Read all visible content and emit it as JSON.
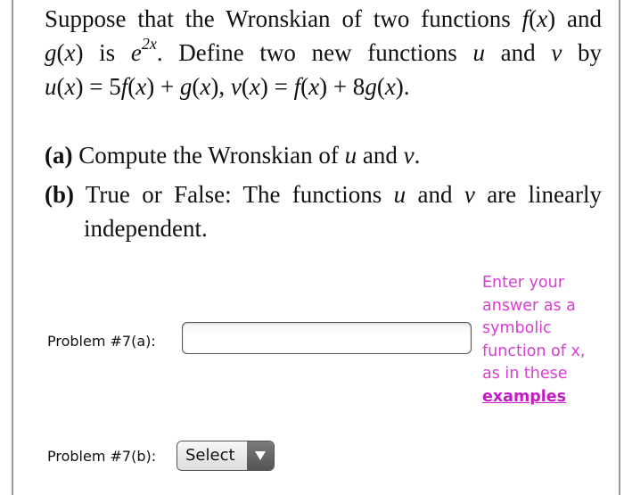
{
  "problem": {
    "intro_lines": [
      {
        "parts": [
          {
            "t": "Suppose that the Wronskian of two functions "
          },
          {
            "t": "f",
            "i": true
          },
          {
            "t": "("
          },
          {
            "t": "x",
            "i": true
          },
          {
            "t": ") and"
          }
        ]
      },
      {
        "parts": [
          {
            "t": "g",
            "i": true
          },
          {
            "t": "("
          },
          {
            "t": "x",
            "i": true
          },
          {
            "t": ") is "
          },
          {
            "t": "e",
            "i": true
          },
          {
            "t": "2x",
            "sup": true
          },
          {
            "t": ". Define two new functions "
          },
          {
            "t": "u",
            "i": true
          },
          {
            "t": " and "
          },
          {
            "t": "v",
            "i": true
          },
          {
            "t": " by"
          }
        ]
      },
      {
        "parts": [
          {
            "t": "u",
            "i": true
          },
          {
            "t": "("
          },
          {
            "t": "x",
            "i": true
          },
          {
            "t": ") = 5"
          },
          {
            "t": "f",
            "i": true
          },
          {
            "t": "("
          },
          {
            "t": "x",
            "i": true
          },
          {
            "t": ") + "
          },
          {
            "t": "g",
            "i": true
          },
          {
            "t": "("
          },
          {
            "t": "x",
            "i": true
          },
          {
            "t": "), "
          },
          {
            "t": "v",
            "i": true
          },
          {
            "t": "("
          },
          {
            "t": "x",
            "i": true
          },
          {
            "t": ") = "
          },
          {
            "t": "f",
            "i": true
          },
          {
            "t": "("
          },
          {
            "t": "x",
            "i": true
          },
          {
            "t": ") + 8"
          },
          {
            "t": "g",
            "i": true
          },
          {
            "t": "("
          },
          {
            "t": "x",
            "i": true
          },
          {
            "t": ")."
          }
        ]
      }
    ],
    "part_a": {
      "marker": "(a)",
      "parts": [
        {
          "t": " Compute the Wronskian of "
        },
        {
          "t": "u",
          "i": true
        },
        {
          "t": " and "
        },
        {
          "t": "v",
          "i": true
        },
        {
          "t": "."
        }
      ]
    },
    "part_b": {
      "marker": "(b)",
      "line1": [
        {
          "t": " True or False: The functions "
        },
        {
          "t": "u",
          "i": true
        },
        {
          "t": " and "
        },
        {
          "t": "v",
          "i": true
        },
        {
          "t": " are linearly"
        }
      ],
      "line2": "independent."
    }
  },
  "answers": {
    "a_label": "Problem #7(a):",
    "a_value": "",
    "hint_text": "Enter your answer as a symbolic function of x, as in these",
    "hint_lines": [
      "Enter your",
      "answer as a",
      "symbolic",
      "function of x,",
      "as in these"
    ],
    "hint_link": "examples",
    "b_label": "Problem #7(b):",
    "b_selected": "Select"
  },
  "colors": {
    "hint": "#d63fcf",
    "link": "#c21bc8"
  }
}
